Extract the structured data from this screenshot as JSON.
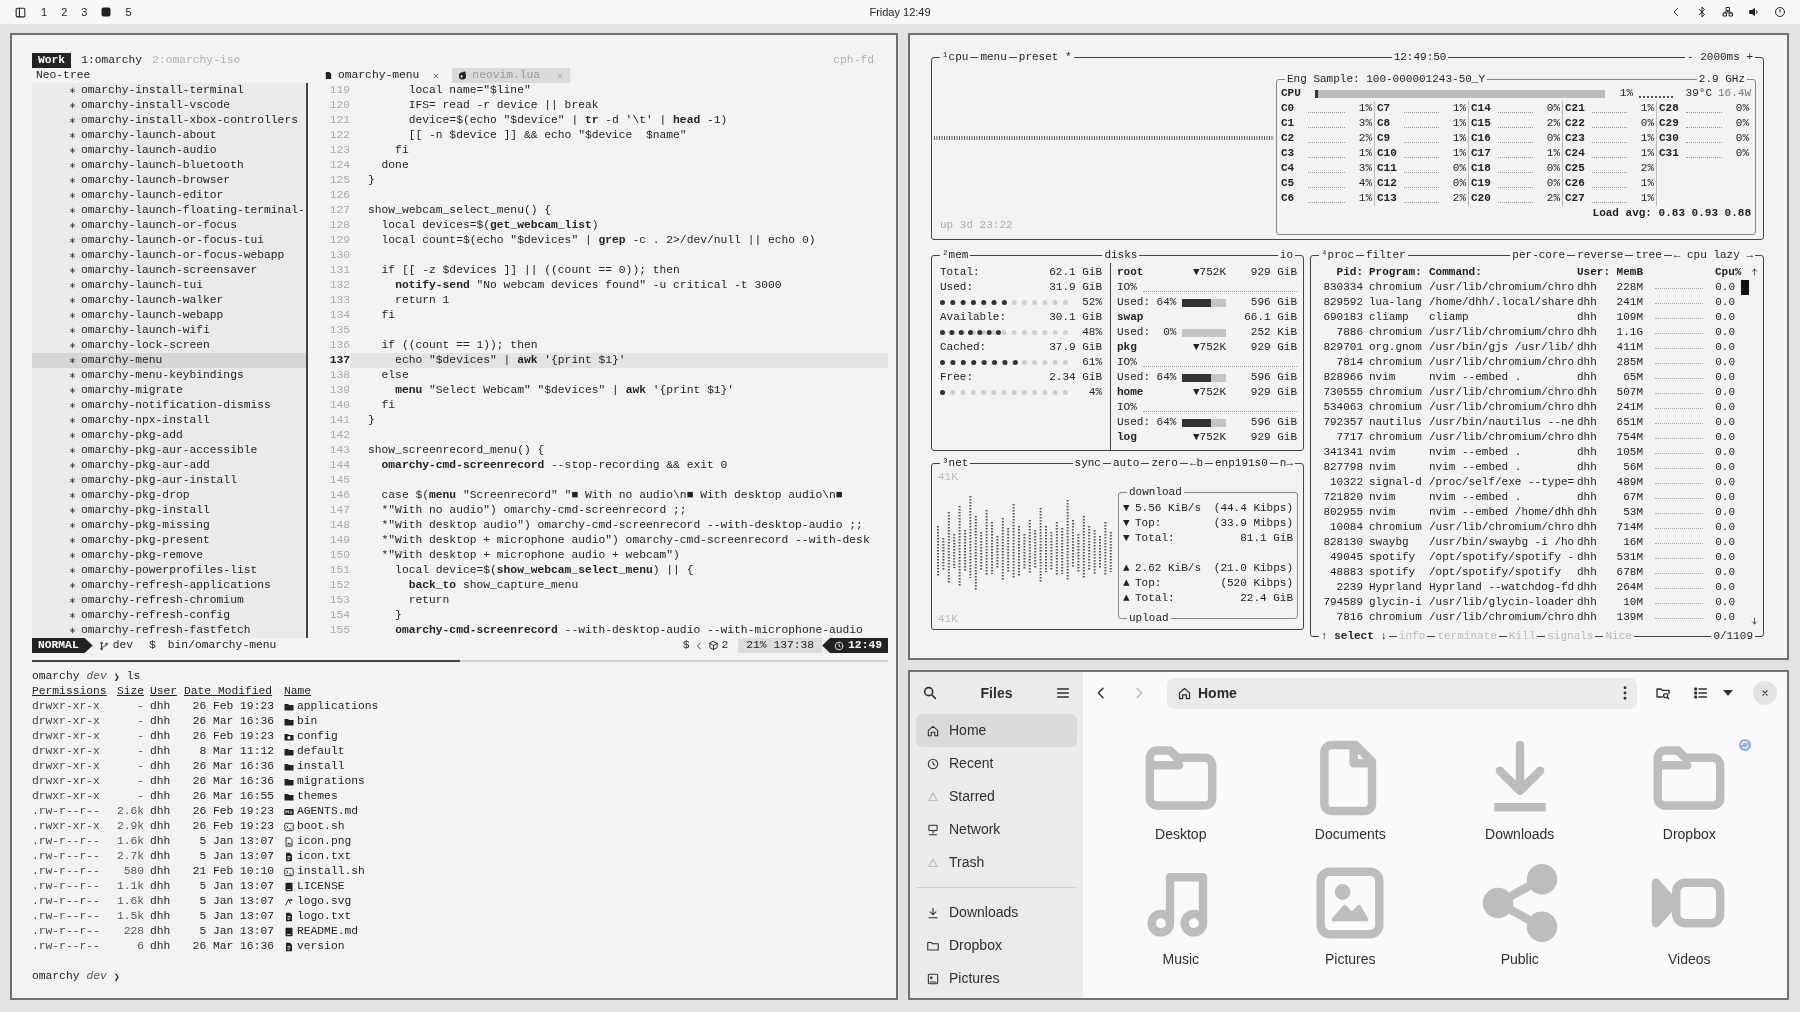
{
  "top_bar": {
    "workspaces": [
      {
        "label": "1",
        "selected": false
      },
      {
        "label": "2",
        "selected": false
      },
      {
        "label": "3",
        "selected": false
      },
      {
        "selected": true
      },
      {
        "label": "5",
        "selected": false
      }
    ],
    "clock": "Friday 12:49"
  },
  "terminal": {
    "tmux": {
      "session": "Work",
      "windows": [
        {
          "label": "1:omarchy",
          "selected": true
        },
        {
          "label": "2:omarchy-iso",
          "selected": false
        }
      ],
      "host": "cph-fd"
    },
    "neo_tree": {
      "title": "Neo-tree",
      "items": [
        {
          "label": "omarchy-install-terminal",
          "selected": false
        },
        {
          "label": "omarchy-install-vscode",
          "selected": false
        },
        {
          "label": "omarchy-install-xbox-controllers",
          "selected": false
        },
        {
          "label": "omarchy-launch-about",
          "selected": false
        },
        {
          "label": "omarchy-launch-audio",
          "selected": false
        },
        {
          "label": "omarchy-launch-bluetooth",
          "selected": false
        },
        {
          "label": "omarchy-launch-browser",
          "selected": false
        },
        {
          "label": "omarchy-launch-editor",
          "selected": false
        },
        {
          "label": "omarchy-launch-floating-terminal-",
          "selected": false
        },
        {
          "label": "omarchy-launch-or-focus",
          "selected": false
        },
        {
          "label": "omarchy-launch-or-focus-tui",
          "selected": false
        },
        {
          "label": "omarchy-launch-or-focus-webapp",
          "selected": false
        },
        {
          "label": "omarchy-launch-screensaver",
          "selected": false
        },
        {
          "label": "omarchy-launch-tui",
          "selected": false
        },
        {
          "label": "omarchy-launch-walker",
          "selected": false
        },
        {
          "label": "omarchy-launch-webapp",
          "selected": false
        },
        {
          "label": "omarchy-launch-wifi",
          "selected": false
        },
        {
          "label": "omarchy-lock-screen",
          "selected": false
        },
        {
          "label": "omarchy-menu",
          "selected": true
        },
        {
          "label": "omarchy-menu-keybindings",
          "selected": false
        },
        {
          "label": "omarchy-migrate",
          "selected": false
        },
        {
          "label": "omarchy-notification-dismiss",
          "selected": false
        },
        {
          "label": "omarchy-npx-install",
          "selected": false
        },
        {
          "label": "omarchy-pkg-add",
          "selected": false
        },
        {
          "label": "omarchy-pkg-aur-accessible",
          "selected": false
        },
        {
          "label": "omarchy-pkg-aur-add",
          "selected": false
        },
        {
          "label": "omarchy-pkg-aur-install",
          "selected": false
        },
        {
          "label": "omarchy-pkg-drop",
          "selected": false
        },
        {
          "label": "omarchy-pkg-install",
          "selected": false
        },
        {
          "label": "omarchy-pkg-missing",
          "selected": false
        },
        {
          "label": "omarchy-pkg-present",
          "selected": false
        },
        {
          "label": "omarchy-pkg-remove",
          "selected": false
        },
        {
          "label": "omarchy-powerprofiles-list",
          "selected": false
        },
        {
          "label": "omarchy-refresh-applications",
          "selected": false
        },
        {
          "label": "omarchy-refresh-chromium",
          "selected": false
        },
        {
          "label": "omarchy-refresh-config",
          "selected": false
        },
        {
          "label": "omarchy-refresh-fastfetch",
          "selected": false
        }
      ]
    },
    "editor": {
      "tabs": [
        {
          "label": "omarchy-menu",
          "selected": true
        },
        {
          "label": "neovim.lua",
          "selected": false
        }
      ],
      "lines": [
        {
          "number": "119",
          "text": "      local name=\"$line\"",
          "current": false
        },
        {
          "number": "120",
          "text": "      IFS= read -r device || break",
          "current": false
        },
        {
          "number": "121",
          "text": "      device=$(echo \"$device\" | **tr** -d '\\t' | **head** -1)",
          "current": false
        },
        {
          "number": "122",
          "text": "      [[ -n $device ]] && echo \"$device  $name\"",
          "current": false
        },
        {
          "number": "123",
          "text": "    fi",
          "current": false
        },
        {
          "number": "124",
          "text": "  done",
          "current": false
        },
        {
          "number": "125",
          "text": "}",
          "current": false
        },
        {
          "number": "126",
          "current": false
        },
        {
          "number": "127",
          "text": "show_webcam_select_menu() {",
          "current": false
        },
        {
          "number": "128",
          "text": "  local devices=$(**get_webcam_list**)",
          "current": false
        },
        {
          "number": "129",
          "text": "  local count=$(echo \"$devices\" | **grep** -c . 2>/dev/null || echo 0)",
          "current": false
        },
        {
          "number": "130",
          "current": false
        },
        {
          "number": "131",
          "text": "  if [[ -z $devices ]] || ((count == 0)); then",
          "current": false
        },
        {
          "number": "132",
          "text": "    **notify-send** \"No webcam devices found\" -u critical -t 3000",
          "current": false
        },
        {
          "number": "133",
          "text": "    return 1",
          "current": false
        },
        {
          "number": "134",
          "text": "  fi",
          "current": false
        },
        {
          "number": "135",
          "current": false
        },
        {
          "number": "136",
          "text": "  if ((count == 1)); then",
          "current": false
        },
        {
          "number": "137",
          "text": "    echo \"$devices\" | **awk** '{print $1}'",
          "current": true
        },
        {
          "number": "138",
          "text": "  else",
          "current": false
        },
        {
          "number": "139",
          "text": "    **menu** \"Select Webcam\" \"$devices\" | **awk** '{print $1}'",
          "current": false
        },
        {
          "number": "140",
          "text": "  fi",
          "current": false
        },
        {
          "number": "141",
          "text": "}",
          "current": false
        },
        {
          "number": "142",
          "current": false
        },
        {
          "number": "143",
          "text": "show_screenrecord_menu() {",
          "current": false
        },
        {
          "number": "144",
          "text": "  **omarchy-cmd-screenrecord** --stop-recording && exit 0",
          "current": false
        },
        {
          "number": "145",
          "current": false
        },
        {
          "number": "146",
          "text": "  case $(**menu** \"Screenrecord\" \"■ With no audio\\n■ With desktop audio\\n■",
          "current": false
        },
        {
          "number": "147",
          "text": "  *\"With no audio\") omarchy-cmd-screenrecord ;;",
          "current": false
        },
        {
          "number": "148",
          "text": "  *\"With desktop audio\") omarchy-cmd-screenrecord --with-desktop-audio ;;",
          "current": false
        },
        {
          "number": "149",
          "text": "  *\"With desktop + microphone audio\") omarchy-cmd-screenrecord --with-desk",
          "current": false
        },
        {
          "number": "150",
          "text": "  *\"With desktop + microphone audio + webcam\")",
          "current": false
        },
        {
          "number": "151",
          "text": "    local device=$(**show_webcam_select_menu**) || {",
          "current": false
        },
        {
          "number": "152",
          "text": "      **back_to** show_capture_menu",
          "current": false
        },
        {
          "number": "153",
          "text": "      return",
          "current": false
        },
        {
          "number": "154",
          "text": "    }",
          "current": false
        },
        {
          "number": "155",
          "text": "    **omarchy-cmd-screenrecord** --with-desktop-audio --with-microphone-audio",
          "current": false
        }
      ]
    },
    "status_line": {
      "mode": "NORMAL",
      "branch": "dev",
      "path_prefix": "$",
      "path": "bin/omarchy-menu",
      "lsp_prefix": "$",
      "lsp_count": "2",
      "position": "21% 137:38",
      "time": "12:49"
    },
    "shell": {
      "prompt": {
        "host": "omarchy",
        "dir": "dev",
        "symbol": "❯"
      },
      "command": "ls",
      "columns": [
        "Permissions",
        "Size",
        "User",
        "Date Modified",
        "Name"
      ],
      "rows": [
        {
          "permissions": "drwxr-xr-x",
          "size": "-",
          "user": "dhh",
          "date": "26 Feb 19:23",
          "name": "applications",
          "kind": "folder"
        },
        {
          "permissions": "drwxr-xr-x",
          "size": "-",
          "user": "dhh",
          "date": "26 Mar 16:36",
          "name": "bin",
          "kind": "folder"
        },
        {
          "permissions": "drwxr-xr-x",
          "size": "-",
          "user": "dhh",
          "date": "26 Feb 19:23",
          "name": "config",
          "kind": "config"
        },
        {
          "permissions": "drwxr-xr-x",
          "size": "-",
          "user": "dhh",
          "date": "8 Mar 11:12",
          "name": "default",
          "kind": "folder"
        },
        {
          "permissions": "drwxr-xr-x",
          "size": "-",
          "user": "dhh",
          "date": "26 Mar 16:36",
          "name": "install",
          "kind": "folder"
        },
        {
          "permissions": "drwxr-xr-x",
          "size": "-",
          "user": "dhh",
          "date": "26 Mar 16:36",
          "name": "migrations",
          "kind": "folder"
        },
        {
          "permissions": "drwxr-xr-x",
          "size": "-",
          "user": "dhh",
          "date": "26 Mar 16:55",
          "name": "themes",
          "kind": "folder"
        },
        {
          "permissions": ".rw-r--r--",
          "size": "2.6k",
          "user": "dhh",
          "date": "26 Feb 19:23",
          "name": "AGENTS.md",
          "kind": "markdown"
        },
        {
          "permissions": ".rwxr-xr-x",
          "size": "2.9k",
          "user": "dhh",
          "date": "26 Feb 19:23",
          "name": "boot.sh",
          "kind": "script"
        },
        {
          "permissions": ".rw-r--r--",
          "size": "1.6k",
          "user": "dhh",
          "date": "5 Jan 13:07",
          "name": "icon.png",
          "kind": "image"
        },
        {
          "permissions": ".rw-r--r--",
          "size": "2.7k",
          "user": "dhh",
          "date": "5 Jan 13:07",
          "name": "icon.txt",
          "kind": "text"
        },
        {
          "permissions": ".rw-r--r--",
          "size": "580",
          "user": "dhh",
          "date": "21 Feb 10:10",
          "name": "install.sh",
          "kind": "script"
        },
        {
          "permissions": ".rw-r--r--",
          "size": "1.1k",
          "user": "dhh",
          "date": "5 Jan 13:07",
          "name": "LICENSE",
          "kind": "book"
        },
        {
          "permissions": ".rw-r--r--",
          "size": "1.6k",
          "user": "dhh",
          "date": "5 Jan 13:07",
          "name": "logo.svg",
          "kind": "vector"
        },
        {
          "permissions": ".rw-r--r--",
          "size": "1.5k",
          "user": "dhh",
          "date": "5 Jan 13:07",
          "name": "logo.txt",
          "kind": "text"
        },
        {
          "permissions": ".rw-r--r--",
          "size": "228",
          "user": "dhh",
          "date": "5 Jan 13:07",
          "name": "README.md",
          "kind": "book"
        },
        {
          "permissions": ".rw-r--r--",
          "size": "6",
          "user": "dhh",
          "date": "26 Mar 16:36",
          "name": "version",
          "kind": "text"
        }
      ],
      "final_prompt": {
        "host": "omarchy",
        "dir": "dev",
        "symbol": "❯"
      }
    }
  },
  "monitor": {
    "cpu": {
      "tabs": [
        "¹cpu",
        "menu",
        "preset *"
      ],
      "clock": "12:49:50",
      "interval": "- 2000ms +",
      "uptime": "up 3d 23:22",
      "model": "Eng Sample: 100-000001243-50_Y",
      "frequency": "2.9 GHz",
      "label": "CPU",
      "level": 0.01,
      "usage": "1%",
      "temperature": "39°C",
      "power": "16.4W",
      "cores": [
        {
          "name": "C0",
          "value": "1%"
        },
        {
          "name": "C1",
          "value": "3%"
        },
        {
          "name": "C2",
          "value": "2%"
        },
        {
          "name": "C3",
          "value": "1%"
        },
        {
          "name": "C4",
          "value": "3%"
        },
        {
          "name": "C5",
          "value": "4%"
        },
        {
          "name": "C6",
          "value": "1%"
        },
        {
          "name": "C7",
          "value": "1%"
        },
        {
          "name": "C8",
          "value": "1%"
        },
        {
          "name": "C9",
          "value": "1%"
        },
        {
          "name": "C10",
          "value": "1%"
        },
        {
          "name": "C11",
          "value": "0%"
        },
        {
          "name": "C12",
          "value": "0%"
        },
        {
          "name": "C13",
          "value": "2%"
        },
        {
          "name": "C14",
          "value": "0%"
        },
        {
          "name": "C15",
          "value": "2%"
        },
        {
          "name": "C16",
          "value": "0%"
        },
        {
          "name": "C17",
          "value": "1%"
        },
        {
          "name": "C18",
          "value": "0%"
        },
        {
          "name": "C19",
          "value": "0%"
        },
        {
          "name": "C20",
          "value": "2%"
        },
        {
          "name": "C21",
          "value": "1%"
        },
        {
          "name": "C22",
          "value": "0%"
        },
        {
          "name": "C23",
          "value": "1%"
        },
        {
          "name": "C24",
          "value": "1%"
        },
        {
          "name": "C25",
          "value": "2%"
        },
        {
          "name": "C26",
          "value": "1%"
        },
        {
          "name": "C27",
          "value": "1%"
        },
        {
          "name": "C28",
          "value": "0%"
        },
        {
          "name": "C29",
          "value": "0%"
        },
        {
          "name": "C30",
          "value": "0%"
        },
        {
          "name": "C31",
          "value": "0%"
        }
      ],
      "load_average": "Load avg: 0.83 0.93 0.88"
    },
    "mem": {
      "title": "²mem",
      "rows": [
        {
          "kind": "stat",
          "label": "Total:",
          "value": "62.1 GiB"
        },
        {
          "kind": "stat",
          "label": "Used:",
          "value": "31.9 GiB"
        },
        {
          "kind": "meter",
          "level": 0.52,
          "percent": "52%"
        },
        {
          "kind": "stat",
          "label": "Available:",
          "value": "30.1 GiB"
        },
        {
          "kind": "meter",
          "level": 0.48,
          "percent": "48%"
        },
        {
          "kind": "stat",
          "label": "Cached:",
          "value": "37.9 GiB"
        },
        {
          "kind": "meter",
          "level": 0.61,
          "percent": "61%"
        },
        {
          "kind": "stat",
          "label": "Free:",
          "value": "2.34 GiB"
        },
        {
          "kind": "meter",
          "level": 0.04,
          "percent": "4%"
        }
      ]
    },
    "disks": {
      "title": "disks",
      "io_title": "io",
      "rows": [
        {
          "kind": "disk",
          "name": "root",
          "io": "▼752K",
          "total": "929 GiB"
        },
        {
          "kind": "io",
          "label": "IO%"
        },
        {
          "kind": "used",
          "label": "Used: 64%",
          "level": 0.64,
          "value": "596 GiB"
        },
        {
          "kind": "disk",
          "name": "swap",
          "total": "66.1 GiB"
        },
        {
          "kind": "used",
          "label": "Used:  0%",
          "value": "252 KiB"
        },
        {
          "kind": "disk",
          "name": "pkg",
          "io": "▼752K",
          "total": "929 GiB"
        },
        {
          "kind": "io",
          "label": "IO%"
        },
        {
          "kind": "used",
          "label": "Used: 64%",
          "level": 0.64,
          "value": "596 GiB"
        },
        {
          "kind": "disk",
          "name": "home",
          "io": "▼752K",
          "total": "929 GiB"
        },
        {
          "kind": "io",
          "label": "IO%"
        },
        {
          "kind": "used",
          "label": "Used: 64%",
          "level": 0.64,
          "value": "596 GiB"
        },
        {
          "kind": "disk",
          "name": "log",
          "io": "▼752K",
          "total": "929 GiB"
        }
      ]
    },
    "net": {
      "title": "³net",
      "options": [
        "sync",
        "auto",
        "zero",
        "←b",
        "enp191s0",
        "n→"
      ],
      "scale_top": "41K",
      "scale_bottom": "41K",
      "download": {
        "title": "download",
        "rows": [
          {
            "arrow": "▼",
            "label": "5.56 KiB/s",
            "value": "(44.4 Kibps)"
          },
          {
            "arrow": "▼",
            "label": "Top:",
            "value": "(33.9 Mibps)"
          },
          {
            "arrow": "▼",
            "label": "Total:",
            "value": "81.1 GiB"
          }
        ]
      },
      "upload": {
        "title": "upload",
        "rows": [
          {
            "arrow": "▲",
            "label": "2.62 KiB/s",
            "value": "(21.0 Kibps)"
          },
          {
            "arrow": "▲",
            "label": "Top:",
            "value": "(520 Kibps)"
          },
          {
            "arrow": "▲",
            "label": "Total:",
            "value": "22.4 GiB"
          }
        ]
      }
    },
    "proc": {
      "title": "⁴proc",
      "filter": "filter",
      "options": [
        "per-core",
        "reverse",
        "tree",
        "← cpu lazy →"
      ],
      "columns": [
        "Pid:",
        "Program:",
        "Command:",
        "User:",
        "MemB",
        "Cpu%"
      ],
      "rows": [
        {
          "pid": "830334",
          "program": "chromium",
          "command": "/usr/lib/chromium/chro",
          "user": "dhh",
          "mem": "228M",
          "cpu": "0.0"
        },
        {
          "pid": "829592",
          "program": "lua-lang",
          "command": "/home/dhh/.local/share",
          "user": "dhh",
          "mem": "241M",
          "cpu": "0.0"
        },
        {
          "pid": "690183",
          "program": "cliamp",
          "command": "cliamp",
          "user": "dhh",
          "mem": "109M",
          "cpu": "0.0"
        },
        {
          "pid": "7886",
          "program": "chromium",
          "command": "/usr/lib/chromium/chro",
          "user": "dhh",
          "mem": "1.1G",
          "cpu": "0.0"
        },
        {
          "pid": "829701",
          "program": "org.gnom",
          "command": "/usr/bin/gjs /usr/lib/",
          "user": "dhh",
          "mem": "411M",
          "cpu": "0.0"
        },
        {
          "pid": "7814",
          "program": "chromium",
          "command": "/usr/lib/chromium/chro",
          "user": "dhh",
          "mem": "285M",
          "cpu": "0.0"
        },
        {
          "pid": "828966",
          "program": "nvim",
          "command": "nvim --embed .",
          "user": "dhh",
          "mem": "65M",
          "cpu": "0.0"
        },
        {
          "pid": "730555",
          "program": "chromium",
          "command": "/usr/lib/chromium/chro",
          "user": "dhh",
          "mem": "507M",
          "cpu": "0.0"
        },
        {
          "pid": "534063",
          "program": "chromium",
          "command": "/usr/lib/chromium/chro",
          "user": "dhh",
          "mem": "241M",
          "cpu": "0.0"
        },
        {
          "pid": "792357",
          "program": "nautilus",
          "command": "/usr/bin/nautilus --ne",
          "user": "dhh",
          "mem": "651M",
          "cpu": "0.0"
        },
        {
          "pid": "7717",
          "program": "chromium",
          "command": "/usr/lib/chromium/chro",
          "user": "dhh",
          "mem": "754M",
          "cpu": "0.0"
        },
        {
          "pid": "341341",
          "program": "nvim",
          "command": "nvim --embed .",
          "user": "dhh",
          "mem": "105M",
          "cpu": "0.0"
        },
        {
          "pid": "827798",
          "program": "nvim",
          "command": "nvim --embed .",
          "user": "dhh",
          "mem": "56M",
          "cpu": "0.0"
        },
        {
          "pid": "10322",
          "program": "signal-d",
          "command": "/proc/self/exe --type=",
          "user": "dhh",
          "mem": "489M",
          "cpu": "0.0"
        },
        {
          "pid": "721820",
          "program": "nvim",
          "command": "nvim --embed .",
          "user": "dhh",
          "mem": "67M",
          "cpu": "0.0"
        },
        {
          "pid": "802955",
          "program": "nvim",
          "command": "nvim --embed /home/dhh",
          "user": "dhh",
          "mem": "53M",
          "cpu": "0.0"
        },
        {
          "pid": "10084",
          "program": "chromium",
          "command": "/usr/lib/chromium/chro",
          "user": "dhh",
          "mem": "714M",
          "cpu": "0.0"
        },
        {
          "pid": "828130",
          "program": "swaybg",
          "command": "/usr/bin/swaybg -i /ho",
          "user": "dhh",
          "mem": "16M",
          "cpu": "0.0"
        },
        {
          "pid": "49045",
          "program": "spotify",
          "command": "/opt/spotify/spotify -",
          "user": "dhh",
          "mem": "531M",
          "cpu": "0.0"
        },
        {
          "pid": "48883",
          "program": "spotify",
          "command": "/opt/spotify/spotify",
          "user": "dhh",
          "mem": "678M",
          "cpu": "0.0"
        },
        {
          "pid": "2239",
          "program": "Hyprland",
          "command": "Hyprland --watchdog-fd",
          "user": "dhh",
          "mem": "264M",
          "cpu": "0.0"
        },
        {
          "pid": "794589",
          "program": "glycin-i",
          "command": "/usr/lib/glycin-loader",
          "user": "dhh",
          "mem": "10M",
          "cpu": "0.0"
        },
        {
          "pid": "7816",
          "program": "chromium",
          "command": "/usr/lib/chromium/chro",
          "user": "dhh",
          "mem": "139M",
          "cpu": "0.0"
        }
      ],
      "footer": [
        {
          "label": "↑ select ↓",
          "disabled": false
        },
        {
          "label": "info",
          "disabled": true
        },
        {
          "label": "terminate",
          "disabled": true
        },
        {
          "label": "Kill",
          "disabled": true
        },
        {
          "label": "signals",
          "disabled": true
        },
        {
          "label": "Nice",
          "disabled": true
        }
      ],
      "count": "0/1109"
    }
  },
  "files": {
    "title": "Files",
    "places": [
      {
        "label": "Home",
        "kind": "home",
        "selected": true
      },
      {
        "label": "Recent",
        "kind": "recent",
        "selected": false
      },
      {
        "label": "Starred",
        "kind": "starred",
        "selected": false
      },
      {
        "label": "Network",
        "kind": "network",
        "selected": false
      },
      {
        "label": "Trash",
        "kind": "trash",
        "selected": false
      }
    ],
    "bookmarks": [
      {
        "label": "Downloads",
        "kind": "download",
        "selected": false
      },
      {
        "label": "Dropbox",
        "kind": "folder",
        "selected": false
      },
      {
        "label": "Pictures",
        "kind": "picture",
        "selected": false
      }
    ],
    "back_disabled": false,
    "forward_disabled": true,
    "path": "Home",
    "items": [
      {
        "label": "Desktop",
        "kind": "folder",
        "emblem": false
      },
      {
        "label": "Documents",
        "kind": "document",
        "emblem": false
      },
      {
        "label": "Downloads",
        "kind": "download",
        "emblem": false
      },
      {
        "label": "Dropbox",
        "kind": "folder",
        "emblem": true
      },
      {
        "label": "Music",
        "kind": "music",
        "emblem": false
      },
      {
        "label": "Pictures",
        "kind": "picture",
        "emblem": false
      },
      {
        "label": "Public",
        "kind": "share",
        "emblem": false
      },
      {
        "label": "Videos",
        "kind": "video",
        "emblem": false
      }
    ]
  }
}
